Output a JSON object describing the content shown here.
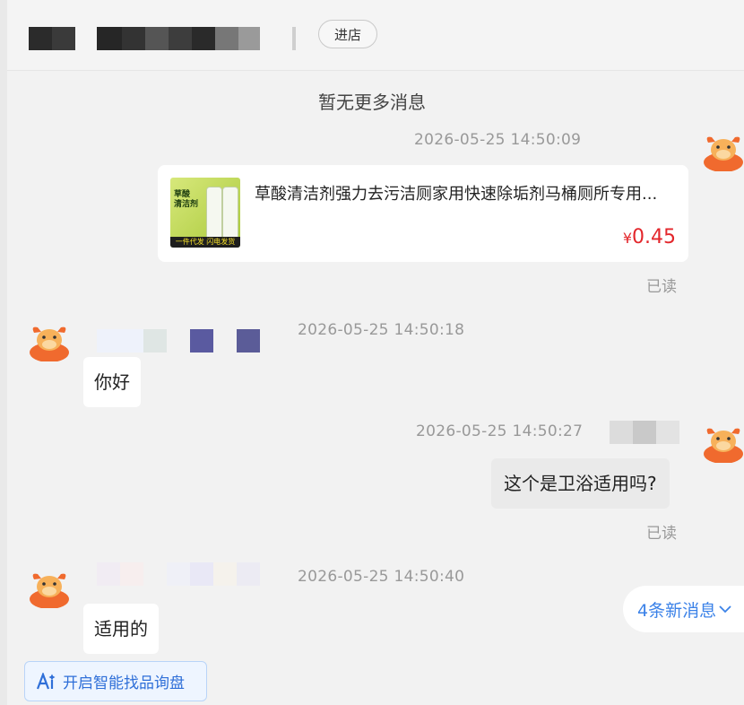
{
  "header": {
    "shop_name_redacted": "",
    "enter_store_label": "进店"
  },
  "chat": {
    "no_more_label": "暂无更多消息",
    "messages": [
      {
        "timestamp": "2026-05-25 14:50:09",
        "product": {
          "thumb_title": "草酸\n清洁剂",
          "thumb_banner": "一件代发 闪电发货",
          "title": "草酸清洁剂强力去污洁厕家用快速除垢剂马桶厕所专用...",
          "currency": "¥",
          "price": "0.45"
        },
        "read_label": "已读"
      },
      {
        "timestamp": "2026-05-25 14:50:18",
        "text": "你好"
      },
      {
        "timestamp": "2026-05-25 14:50:27",
        "text": "这个是卫浴适用吗?",
        "read_label": "已读"
      },
      {
        "timestamp": "2026-05-25 14:50:40",
        "text": "适用的"
      }
    ],
    "new_messages_label": "4条新消息",
    "ai_button_label": "开启智能找品询盘"
  },
  "colors": {
    "price": "#e3262b",
    "link_blue": "#3b82e8",
    "avatar_orange": "#f06a2e"
  }
}
